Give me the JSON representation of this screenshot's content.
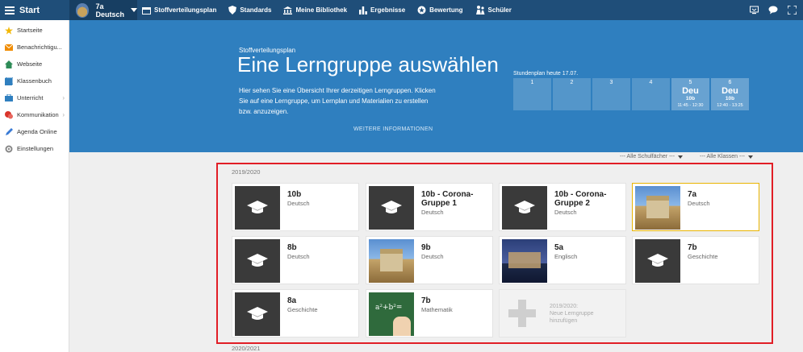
{
  "topbar": {
    "start_label": "Start",
    "class_name": "7a",
    "class_subject": "Deutsch",
    "nav": [
      {
        "label": "Stoffverteilungsplan",
        "icon": "calendar-icon"
      },
      {
        "label": "Standards",
        "icon": "shield-icon"
      },
      {
        "label": "Meine Bibliothek",
        "icon": "library-icon"
      },
      {
        "label": "Ergebnisse",
        "icon": "bar-chart-icon"
      },
      {
        "label": "Bewertung",
        "icon": "star-circle-icon"
      },
      {
        "label": "Schüler",
        "icon": "students-icon"
      }
    ]
  },
  "sidebar": {
    "items": [
      {
        "label": "Startseite",
        "icon": "star-icon",
        "color": "#f2b705"
      },
      {
        "label": "Benachrichtigu...",
        "icon": "envelope-icon",
        "color": "#f08c00"
      },
      {
        "label": "Webseite",
        "icon": "home-icon",
        "color": "#2e8b57"
      },
      {
        "label": "Klassenbuch",
        "icon": "book-icon",
        "color": "#2f7fbf"
      },
      {
        "label": "Unterricht",
        "icon": "briefcase-icon",
        "color": "#2f7fbf"
      },
      {
        "label": "Kommunikation",
        "icon": "chat-icon",
        "color": "#d9342b"
      },
      {
        "label": "Agenda Online",
        "icon": "pen-icon",
        "color": "#3a7bd5"
      },
      {
        "label": "Einstellungen",
        "icon": "gear-icon",
        "color": "#888888"
      }
    ]
  },
  "banner": {
    "eyebrow": "Stoffverteilungsplan",
    "title": "Eine Lerngruppe auswählen",
    "desc": "Hier sehen Sie eine Übersicht Ihrer derzeitigen Lerngruppen. Klicken Sie auf eine Lerngruppe, um Lernplan und Materialien zu erstellen bzw. anzuzeigen.",
    "more": "WEITERE INFORMATIONEN",
    "schedule_label": "Stundenplan heute 17.07.",
    "slots": [
      {
        "num": "1",
        "subject": "",
        "cls": "",
        "time": ""
      },
      {
        "num": "2",
        "subject": "",
        "cls": "",
        "time": ""
      },
      {
        "num": "3",
        "subject": "",
        "cls": "",
        "time": ""
      },
      {
        "num": "4",
        "subject": "",
        "cls": "",
        "time": ""
      },
      {
        "num": "5",
        "subject": "Deu",
        "cls": "10b",
        "time": "11:45 - 12:30"
      },
      {
        "num": "6",
        "subject": "Deu",
        "cls": "10b",
        "time": "12:40 - 13:25"
      }
    ]
  },
  "filters": {
    "subject": "--- Alle Schulfächer ---",
    "classes": "--- Alle Klassen ---"
  },
  "years": {
    "current": "2019/2020",
    "next": "2020/2021"
  },
  "cards": [
    {
      "title": "10b",
      "sub": "Deutsch",
      "img": "generic"
    },
    {
      "title": "10b - Corona-Gruppe 1",
      "sub": "Deutsch",
      "img": "generic"
    },
    {
      "title": "10b - Corona-Gruppe 2",
      "sub": "Deutsch",
      "img": "generic"
    },
    {
      "title": "7a",
      "sub": "Deutsch",
      "img": "building"
    },
    {
      "title": "8b",
      "sub": "Deutsch",
      "img": "generic"
    },
    {
      "title": "9b",
      "sub": "Deutsch",
      "img": "building"
    },
    {
      "title": "5a",
      "sub": "Englisch",
      "img": "london"
    },
    {
      "title": "7b",
      "sub": "Geschichte",
      "img": "generic"
    },
    {
      "title": "8a",
      "sub": "Geschichte",
      "img": "generic"
    },
    {
      "title": "7b",
      "sub": "Mathematik",
      "img": "board"
    }
  ],
  "add_card": {
    "line1": "2019/2020:",
    "line2": "Neue Lerngruppe",
    "line3": "hinzufügen"
  }
}
